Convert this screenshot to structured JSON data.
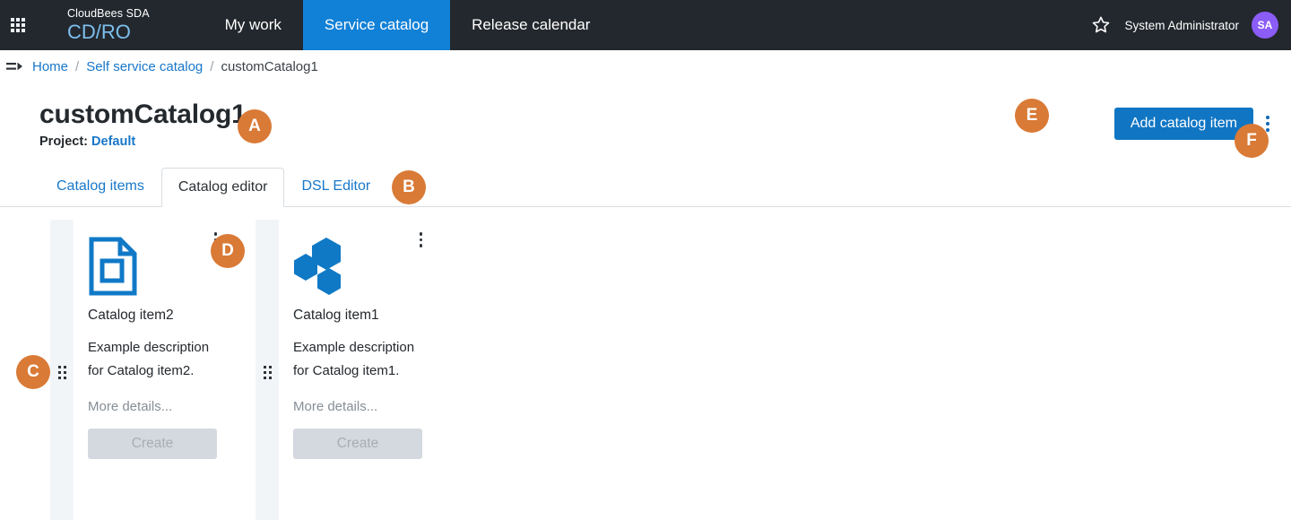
{
  "topnav": {
    "apps_icon": "apps-grid-icon",
    "brand_top": "CloudBees SDA",
    "brand_bottom": "CD/RO",
    "items": [
      {
        "label": "My work",
        "active": false
      },
      {
        "label": "Service catalog",
        "active": true
      },
      {
        "label": "Release calendar",
        "active": false
      }
    ],
    "favorite_icon": "star-icon",
    "user_name": "System Administrator",
    "avatar_initials": "SA",
    "avatar_color": "#8b5cf6",
    "background": "#23282e",
    "active_tab_color": "#1180d7"
  },
  "breadcrumb": {
    "icon": "expand-sidebar-icon",
    "items": [
      {
        "label": "Home",
        "link": true
      },
      {
        "label": "Self service catalog",
        "link": true
      },
      {
        "label": "customCatalog1",
        "link": false
      }
    ],
    "separator": "/"
  },
  "page": {
    "title": "customCatalog1",
    "project_label": "Project:",
    "project_value": "Default",
    "add_item_button": "Add catalog item",
    "overflow_menu_icon": "kebab-menu-icon",
    "primary_color": "#1076c4"
  },
  "tabs": [
    {
      "label": "Catalog items",
      "active": false
    },
    {
      "label": "Catalog editor",
      "active": true
    },
    {
      "label": "DSL Editor",
      "active": false
    }
  ],
  "cards": [
    {
      "icon": "document-icon",
      "title": "Catalog item2",
      "description": "Example description for Catalog item2.",
      "more_details": "More details...",
      "create_button": "Create",
      "drag_handle_icon": "drag-handle-icon",
      "menu_icon": "kebab-menu-icon"
    },
    {
      "icon": "hexagons-icon",
      "title": "Catalog item1",
      "description": "Example description for Catalog item1.",
      "more_details": "More details...",
      "create_button": "Create",
      "drag_handle_icon": "drag-handle-icon",
      "menu_icon": "kebab-menu-icon"
    }
  ],
  "callouts": {
    "color": "#d97a36",
    "a": "A",
    "b": "B",
    "c": "C",
    "d": "D",
    "e": "E",
    "f": "F"
  }
}
